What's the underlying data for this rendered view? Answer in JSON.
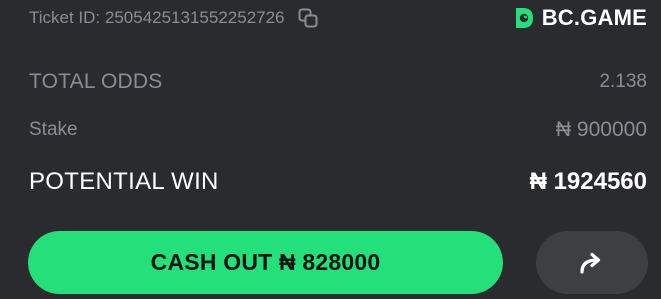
{
  "ticket": {
    "label": "Ticket ID: 2505425131552252726"
  },
  "brand": {
    "name": "BC.GAME",
    "logo_icon": "bc-game-logo-icon",
    "accent": "#23e07a"
  },
  "summary": {
    "total_odds_label": "TOTAL ODDS",
    "total_odds_value": "2.138",
    "stake_label": "Stake",
    "stake_value": "₦ 900000",
    "potential_win_label": "POTENTIAL WIN",
    "potential_win_value": "₦ 1924560"
  },
  "actions": {
    "cash_out_label": "CASH OUT ₦ 828000",
    "share_icon": "share-arrow-icon"
  },
  "colors": {
    "background": "#2a2b2e",
    "muted_text": "#8a8d93",
    "primary_button": "#23e07a",
    "secondary_button": "#3e3f43"
  }
}
